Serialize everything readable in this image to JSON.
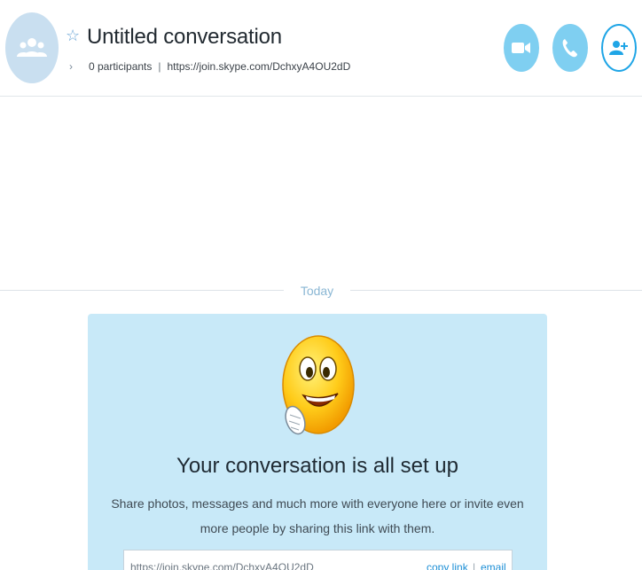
{
  "header": {
    "title": "Untitled conversation",
    "participants": "0 participants",
    "separator": "|",
    "join_link": "https://join.skype.com/DchxyA4OU2dD",
    "icons": {
      "avatar": "group-icon",
      "favorite": "star-icon",
      "expand": "chevron-right-icon",
      "video": "video-call-icon",
      "call": "phone-icon",
      "add": "add-person-icon"
    }
  },
  "timeline": {
    "today_label": "Today"
  },
  "card": {
    "emoticon": "smile-emoticon",
    "title": "Your conversation is all set up",
    "description": "Share photos, messages and much more with everyone here or invite even more people by sharing this link with them.",
    "link_value": "https://join.skype.com/DchxyA4OU2dD",
    "copy_link_label": "copy link",
    "separator": "|",
    "email_label": "email"
  },
  "colors": {
    "accent": "#1fa5e6",
    "button_light": "#7fcff1",
    "card_background": "#c8e9f8",
    "avatar_background": "#c9dff0"
  }
}
